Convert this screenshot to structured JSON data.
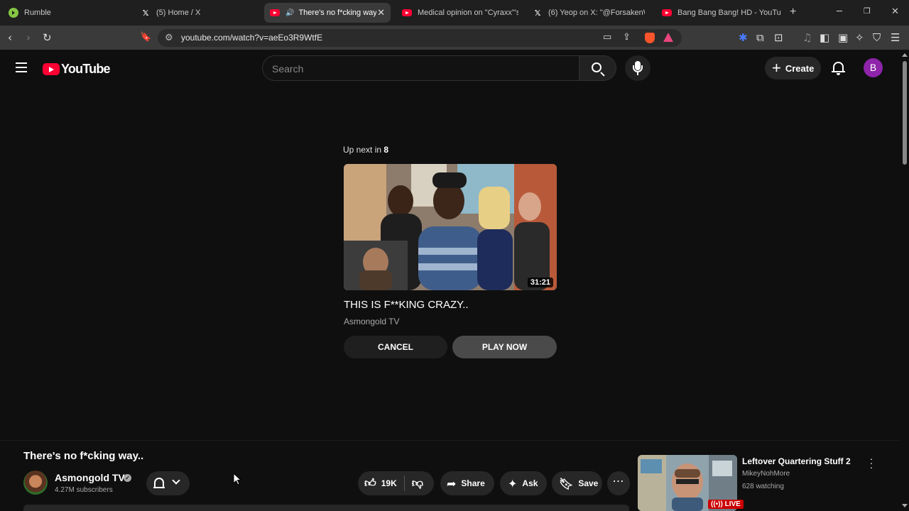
{
  "browser": {
    "tabs": [
      {
        "title": "Rumble",
        "icon": "rumble-icon"
      },
      {
        "title": "(5) Home / X",
        "icon": "x-icon"
      },
      {
        "title": "There's no f*cking way..",
        "icon": "youtube-icon",
        "active": true,
        "audio": true
      },
      {
        "title": "Medical opinion on \"Cyraxx\"'s m",
        "icon": "youtube-icon"
      },
      {
        "title": "(6) Yeop on X: \"@ForsakenWan",
        "icon": "x-icon"
      },
      {
        "title": "Bang Bang Bang! HD - YouTube",
        "icon": "youtube-icon"
      }
    ],
    "url": "youtube.com/watch?v=aeEo3R9WtfE"
  },
  "youtube": {
    "logo_text": "YouTube",
    "search_placeholder": "Search",
    "create_label": "Create",
    "avatar_letter": "B",
    "avatar_color": "#8e24aa"
  },
  "endscreen": {
    "upnext_label": "Up next in",
    "countdown": "8",
    "duration": "31:21",
    "title": "THIS IS F**KING CRAZY..",
    "channel": "Asmongold TV",
    "cancel_label": "CANCEL",
    "play_label": "PLAY NOW"
  },
  "video": {
    "title": "There's no f*cking way..",
    "channel": "Asmongold TV",
    "subscribers": "4.27M subscribers",
    "likes": "19K",
    "share_label": "Share",
    "ask_label": "Ask",
    "save_label": "Save"
  },
  "recommendation": {
    "title": "Leftover Quartering Stuff 2",
    "channel": "MikeyNohMore",
    "watching": "628 watching",
    "live_label": "LIVE"
  }
}
